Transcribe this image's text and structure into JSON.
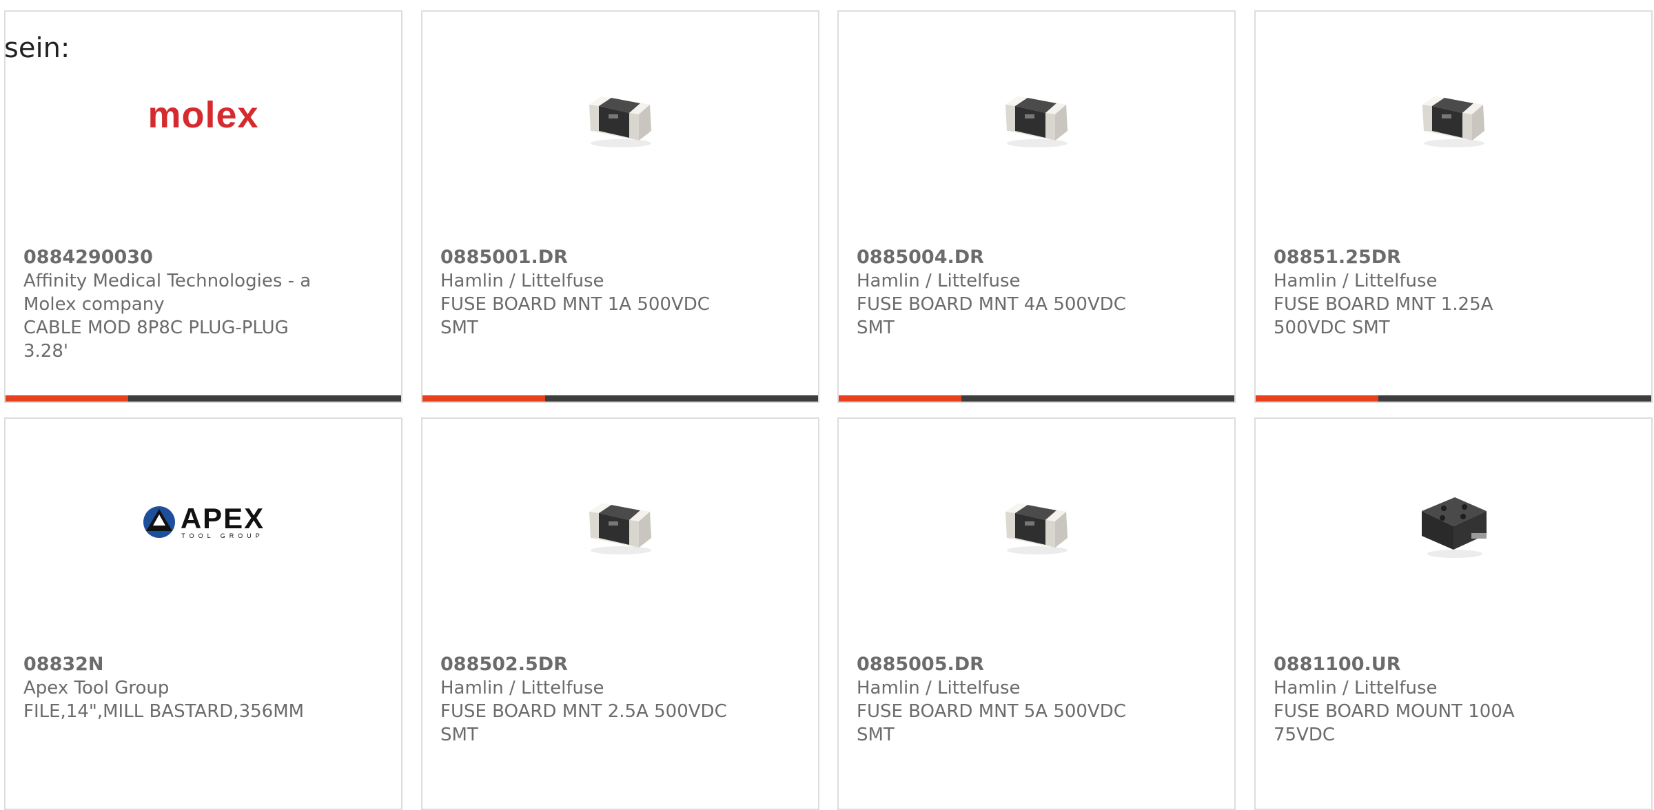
{
  "intro_text": "sein:",
  "colors": {
    "accent": "#e8401c",
    "bar": "#3d3d3d",
    "molex_red": "#d52b2f"
  },
  "progress_fraction": 0.31,
  "products": [
    {
      "part_number": "0884290030",
      "manufacturer": "Affinity Medical Technologies - a Molex company",
      "description": "CABLE MOD 8P8C PLUG-PLUG 3.28'",
      "image": "molex-logo",
      "logo_text": "molex"
    },
    {
      "part_number": "0885001.DR",
      "manufacturer": "Hamlin / Littelfuse",
      "description": "FUSE BOARD MNT 1A 500VDC SMT",
      "image": "smd-fuse-icon"
    },
    {
      "part_number": "0885004.DR",
      "manufacturer": "Hamlin / Littelfuse",
      "description": "FUSE BOARD MNT 4A 500VDC SMT",
      "image": "smd-fuse-icon"
    },
    {
      "part_number": "08851.25DR",
      "manufacturer": "Hamlin / Littelfuse",
      "description": "FUSE BOARD MNT 1.25A 500VDC SMT",
      "image": "smd-fuse-icon"
    },
    {
      "part_number": "08832N",
      "manufacturer": "Apex Tool Group",
      "description": "FILE,14\",MILL BASTARD,356MM",
      "image": "apex-logo",
      "logo_text": "APEX",
      "logo_subtext": "TOOL GROUP"
    },
    {
      "part_number": "088502.5DR",
      "manufacturer": "Hamlin / Littelfuse",
      "description": "FUSE BOARD MNT 2.5A 500VDC SMT",
      "image": "smd-fuse-icon"
    },
    {
      "part_number": "0885005.DR",
      "manufacturer": "Hamlin / Littelfuse",
      "description": "FUSE BOARD MNT 5A 500VDC SMT",
      "image": "smd-fuse-icon"
    },
    {
      "part_number": "0881100.UR",
      "manufacturer": "Hamlin / Littelfuse",
      "description": "FUSE BOARD MOUNT 100A 75VDC",
      "image": "fuse-block-icon"
    }
  ]
}
